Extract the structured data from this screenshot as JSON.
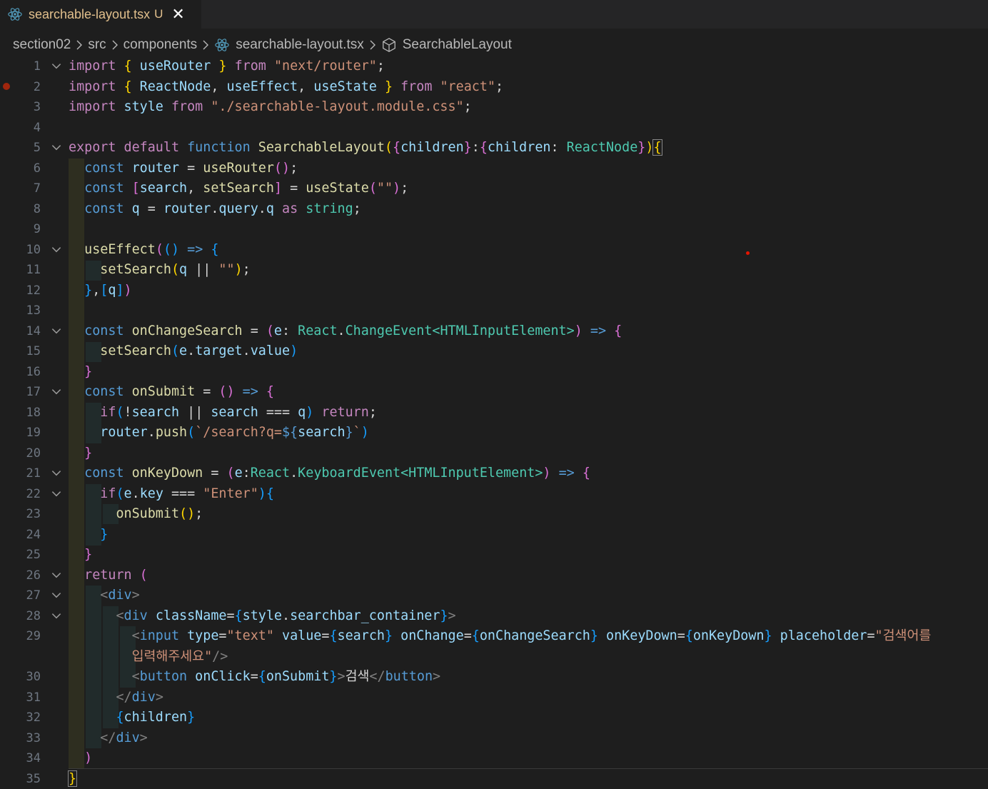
{
  "tab": {
    "filename": "searchable-layout.tsx",
    "status": "U",
    "close": "✕"
  },
  "breadcrumb": {
    "items": [
      "section02",
      "src",
      "components",
      "searchable-layout.tsx",
      "SearchableLayout"
    ]
  },
  "editor": {
    "line_numbers": [
      "1",
      "2",
      "3",
      "4",
      "5",
      "6",
      "7",
      "8",
      "9",
      "10",
      "11",
      "12",
      "13",
      "14",
      "15",
      "16",
      "17",
      "18",
      "19",
      "20",
      "21",
      "22",
      "23",
      "24",
      "25",
      "26",
      "27",
      "28",
      "29",
      "30",
      "31",
      "32",
      "33",
      "34",
      "35"
    ]
  },
  "colors": {
    "keyword": "#569cd6",
    "control": "#c586c0",
    "function": "#dcdcaa",
    "variable": "#9cdcfe",
    "string": "#ce9178",
    "type": "#4ec9b0",
    "bracket1": "#ffd700",
    "bracket2": "#da70d6",
    "bracket3": "#179fff",
    "modified": "#e2c08d",
    "breakpoint": "#a1260d"
  },
  "icons": [
    "react-icon",
    "chevron-right-icon",
    "symbol-class-icon",
    "chevron-down-icon",
    "close-icon",
    "breakpoint-icon"
  ]
}
